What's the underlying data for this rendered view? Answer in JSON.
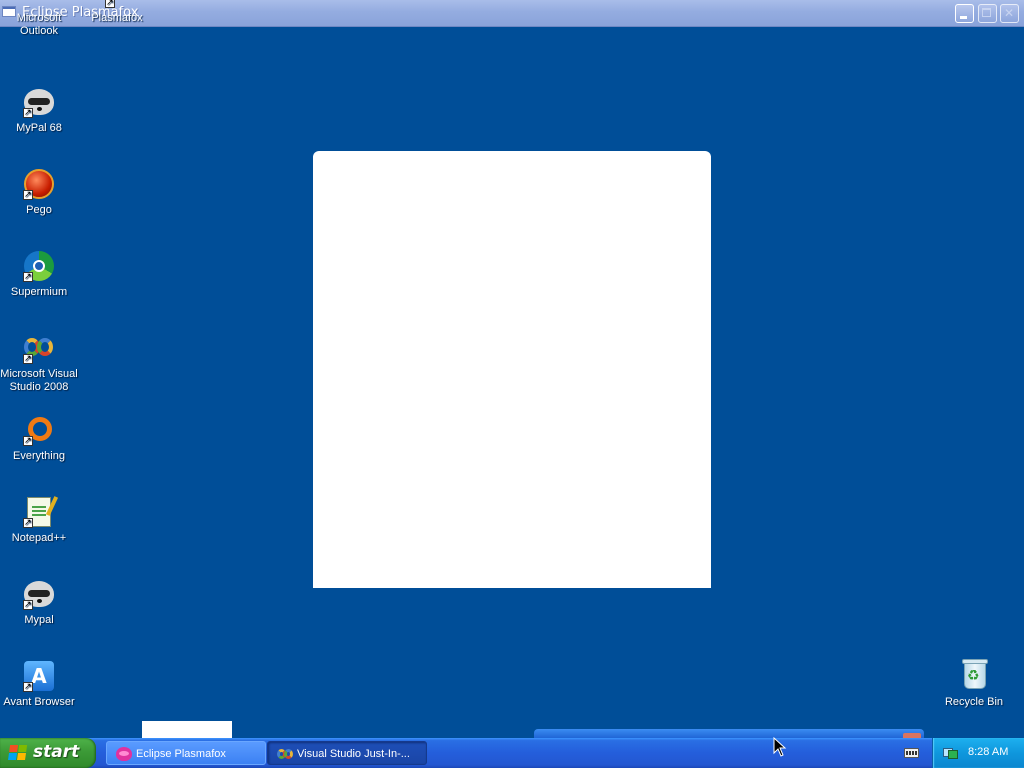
{
  "window": {
    "title": "Eclipse Plasmafox"
  },
  "desktop": {
    "icons_left": [
      {
        "name": "microsoft-outlook",
        "label": "Microsoft Outlook",
        "icon": "outlook-icon"
      },
      {
        "name": "plasmafox",
        "label": "Plasmafox",
        "icon": "plasmafox-icon"
      },
      {
        "name": "mypal-68",
        "label": "MyPal 68",
        "icon": "raccoon-icon"
      },
      {
        "name": "pego",
        "label": "Pego",
        "icon": "pego-icon"
      },
      {
        "name": "supermium",
        "label": "Supermium",
        "icon": "supermium-icon"
      },
      {
        "name": "visual-studio-2008",
        "label": "Microsoft Visual Studio 2008",
        "icon": "visual-studio-icon"
      },
      {
        "name": "everything",
        "label": "Everything",
        "icon": "everything-icon"
      },
      {
        "name": "notepad-plus-plus",
        "label": "Notepad++",
        "icon": "notepad-icon"
      },
      {
        "name": "mypal",
        "label": "Mypal",
        "icon": "raccoon-icon"
      },
      {
        "name": "avant-browser",
        "label": "Avant Browser",
        "icon": "avant-icon"
      }
    ],
    "recycle_bin": {
      "label": "Recycle Bin",
      "icon": "recycle-bin-icon"
    }
  },
  "taskbar": {
    "start_label": "start",
    "tasks": [
      {
        "label": "Eclipse Plasmafox",
        "icon": "plasmafox-icon",
        "active": false
      },
      {
        "label": "Visual Studio Just-In-...",
        "icon": "visual-studio-icon",
        "active": true
      }
    ],
    "clock": "8:28 AM"
  },
  "colors": {
    "desktop_background": "#004e98",
    "taskbar_blue": "#245edb",
    "start_green": "#3c9a37",
    "tray_blue": "#0f97dd"
  }
}
